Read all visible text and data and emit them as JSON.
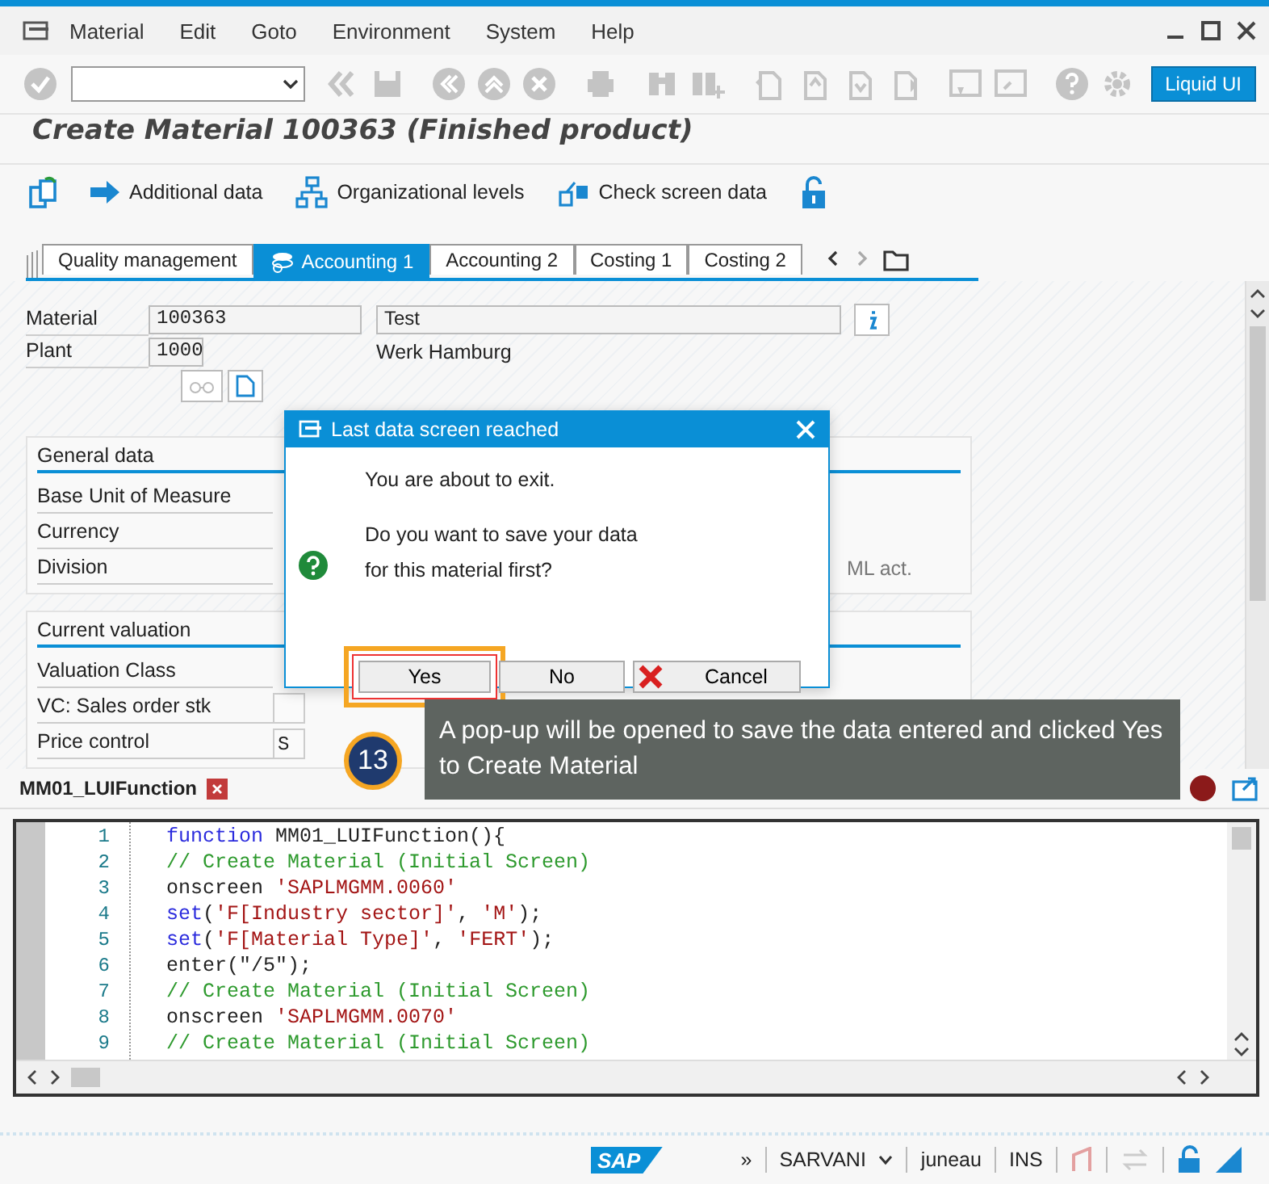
{
  "window": {
    "menu": [
      "Material",
      "Edit",
      "Goto",
      "Environment",
      "System",
      "Help"
    ]
  },
  "toolbar": {
    "liquid_ui_button": "Liquid UI"
  },
  "title": "Create Material 100363 (Finished product)",
  "actions": [
    "Additional data",
    "Organizational levels",
    "Check screen data"
  ],
  "tabs": [
    {
      "label": "Quality management",
      "selected": false
    },
    {
      "label": "Accounting 1",
      "selected": true
    },
    {
      "label": "Accounting 2",
      "selected": false
    },
    {
      "label": "Costing 1",
      "selected": false
    },
    {
      "label": "Costing 2",
      "selected": false
    }
  ],
  "header": {
    "material_label": "Material",
    "material": "100363",
    "description": "Test",
    "plant_label": "Plant",
    "plant": "1000",
    "plant_name": "Werk Hamburg"
  },
  "sections": [
    {
      "title": "General data",
      "fields": [
        {
          "label": "Base Unit of Measure",
          "kind": "covered"
        },
        {
          "label": "Currency",
          "kind": "covered"
        },
        {
          "label": "Division",
          "kind": "covered"
        }
      ],
      "note": "ML act."
    },
    {
      "title": "Current valuation",
      "fields": [
        {
          "label": "Valuation Class",
          "kind": "covered"
        },
        {
          "label": "VC: Sales order stk",
          "kind": "input"
        },
        {
          "label": "Price control",
          "kind": "input",
          "value": "S"
        }
      ]
    }
  ],
  "popup": {
    "title": "Last data screen reached",
    "message": "You are about to exit.",
    "question_lines": [
      "Do you want to save your data",
      "for this material first?"
    ],
    "buttons": [
      {
        "label": "Yes",
        "kind": "yes",
        "focused": true,
        "highlighted": true
      },
      {
        "label": "No",
        "kind": "no",
        "focused": false,
        "highlighted": false
      },
      {
        "label": "Cancel",
        "kind": "cancel",
        "focused": false,
        "highlighted": false
      }
    ]
  },
  "callout": {
    "step": "13",
    "text": "A pop-up will be opened to save the data entered and clicked Yes to Create Material"
  },
  "script_tab": {
    "label": "MM01_LUIFunction"
  },
  "editor": {
    "lines": [
      {
        "number": "1",
        "tokens": [
          {
            "text": "function",
            "kind": "keyword"
          },
          {
            "text": " MM01_LUIFunction(){",
            "kind": "plain"
          }
        ]
      },
      {
        "number": "2",
        "tokens": [
          {
            "text": "// Create Material (Initial Screen)",
            "kind": "comment"
          }
        ]
      },
      {
        "number": "3",
        "tokens": [
          {
            "text": "onscreen ",
            "kind": "plain"
          },
          {
            "text": "'SAPLMGMM.0060'",
            "kind": "string"
          }
        ]
      },
      {
        "number": "4",
        "tokens": [
          {
            "text": "set",
            "kind": "keyword"
          },
          {
            "text": "(",
            "kind": "plain"
          },
          {
            "text": "'F[Industry sector]'",
            "kind": "string"
          },
          {
            "text": ", ",
            "kind": "plain"
          },
          {
            "text": "'M'",
            "kind": "string"
          },
          {
            "text": ");",
            "kind": "plain"
          }
        ]
      },
      {
        "number": "5",
        "tokens": [
          {
            "text": "set",
            "kind": "keyword"
          },
          {
            "text": "(",
            "kind": "plain"
          },
          {
            "text": "'F[Material Type]'",
            "kind": "string"
          },
          {
            "text": ", ",
            "kind": "plain"
          },
          {
            "text": "'FERT'",
            "kind": "string"
          },
          {
            "text": ");",
            "kind": "plain"
          }
        ]
      },
      {
        "number": "6",
        "tokens": [
          {
            "text": "enter(\"/5\");",
            "kind": "plain"
          }
        ]
      },
      {
        "number": "7",
        "tokens": [
          {
            "text": "// Create Material (Initial Screen)",
            "kind": "comment"
          }
        ]
      },
      {
        "number": "8",
        "tokens": [
          {
            "text": "onscreen ",
            "kind": "plain"
          },
          {
            "text": "'SAPLMGMM.0070'",
            "kind": "string"
          }
        ]
      },
      {
        "number": "9",
        "tokens": [
          {
            "text": "// Create Material (Initial Screen)",
            "kind": "comment"
          }
        ]
      }
    ]
  },
  "status_bar": {
    "logo": "SAP",
    "expand": "»",
    "system": "SARVANI",
    "client": "juneau",
    "mode": "INS"
  }
}
